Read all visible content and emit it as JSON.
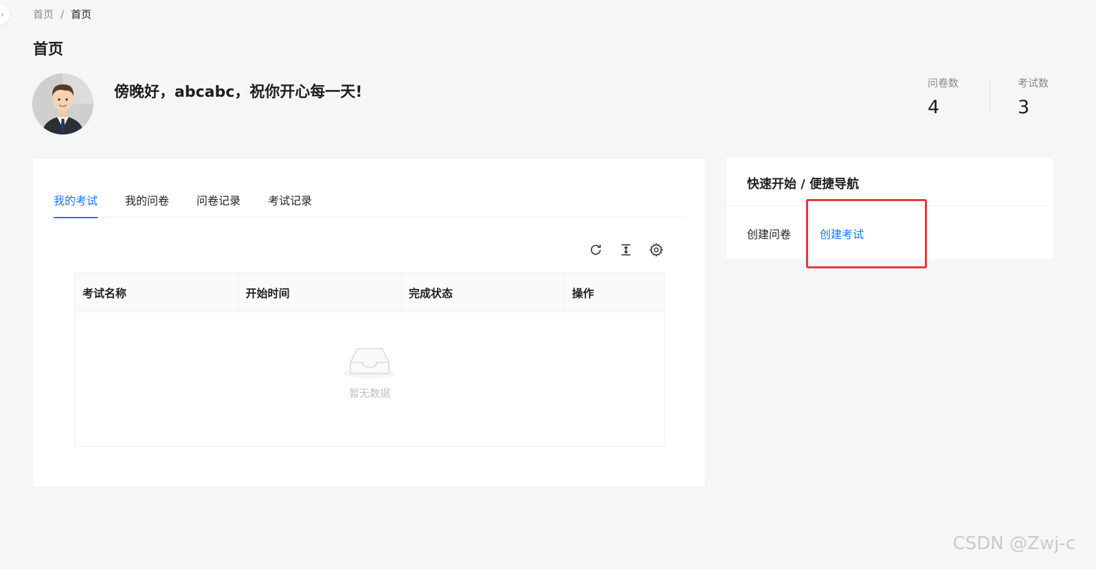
{
  "breadcrumb": {
    "home": "首页",
    "separator": "/",
    "current": "首页"
  },
  "page_title": "首页",
  "greeting": "傍晚好，abcabc，祝你开心每一天!",
  "stats": [
    {
      "label": "问卷数",
      "value": "4"
    },
    {
      "label": "考试数",
      "value": "3"
    }
  ],
  "tabs": [
    {
      "label": "我的考试",
      "active": true
    },
    {
      "label": "我的问卷",
      "active": false
    },
    {
      "label": "问卷记录",
      "active": false
    },
    {
      "label": "考试记录",
      "active": false
    }
  ],
  "toolbar": {
    "icons": [
      "reload-icon",
      "column-height-icon",
      "setting-icon"
    ]
  },
  "table": {
    "columns": [
      "考试名称",
      "开始时间",
      "完成状态",
      "操作"
    ],
    "rows": [],
    "empty_text": "暂无数据"
  },
  "quick_nav": {
    "title": "快速开始 / 便捷导航",
    "links": [
      {
        "label": "创建问卷",
        "color": "#000000"
      },
      {
        "label": "创建考试",
        "color": "#1677ff"
      }
    ],
    "highlight_color": "#e53935"
  },
  "watermark": "CSDN @Zwj-c",
  "colors": {
    "accent": "#1677ff",
    "background": "#f5f6f8"
  }
}
